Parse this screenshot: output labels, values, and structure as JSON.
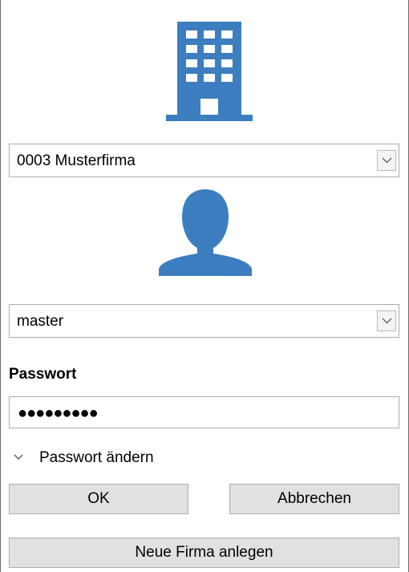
{
  "colors": {
    "icon_blue": "#3c7ebf",
    "button_face": "#e1e1e1",
    "border": "#acacac"
  },
  "company_icon": "building-icon",
  "company_select": {
    "value": "0003 Musterfirma",
    "icon": "chevron-down-icon"
  },
  "user_icon": "user-silhouette-icon",
  "user_select": {
    "value": "master",
    "icon": "chevron-down-icon"
  },
  "password": {
    "label": "Passwort",
    "masked_value": "●●●●●●●●●"
  },
  "change_password": {
    "label": "Passwort ändern",
    "icon": "chevron-down-icon"
  },
  "buttons": {
    "ok": "OK",
    "cancel": "Abbrechen",
    "new_company": "Neue Firma anlegen"
  }
}
